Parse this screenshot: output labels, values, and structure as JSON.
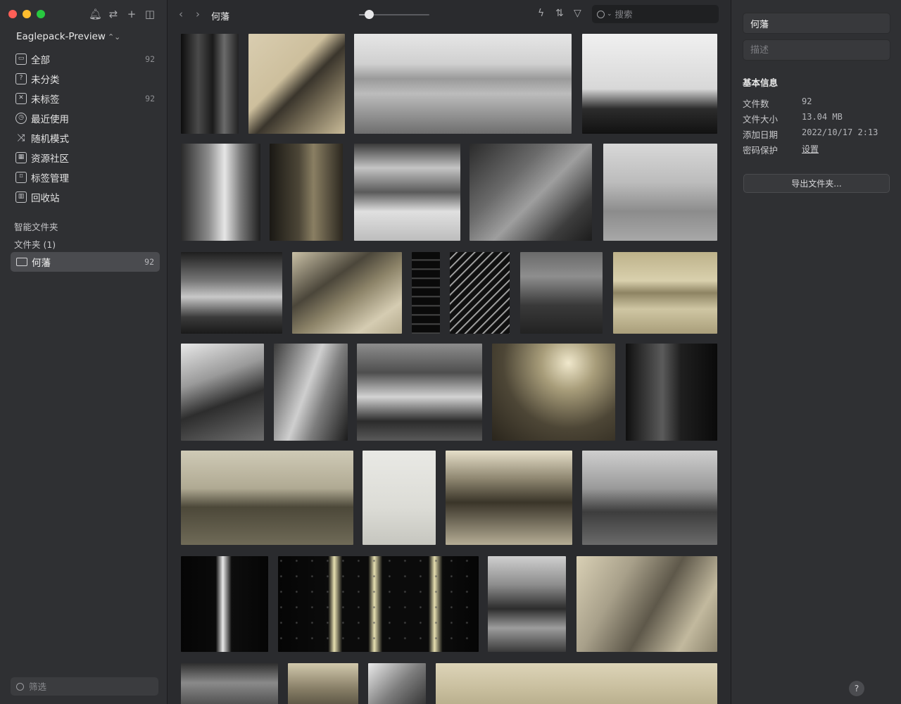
{
  "sidebar": {
    "library_name": "Eaglepack-Preview",
    "nav_items": [
      {
        "label": "全部",
        "count": "92",
        "icon": "inbox-icon"
      },
      {
        "label": "未分类",
        "count": "",
        "icon": "question-box-icon"
      },
      {
        "label": "未标签",
        "count": "92",
        "icon": "tag-off-icon"
      },
      {
        "label": "最近使用",
        "count": "",
        "icon": "clock-icon"
      },
      {
        "label": "随机模式",
        "count": "",
        "icon": "shuffle-icon"
      },
      {
        "label": "资源社区",
        "count": "",
        "icon": "community-icon"
      },
      {
        "label": "标签管理",
        "count": "",
        "icon": "bookmark-icon"
      },
      {
        "label": "回收站",
        "count": "",
        "icon": "trash-icon"
      }
    ],
    "smart_folders_label": "智能文件夹",
    "folders_label": "文件夹 (1)",
    "folder": {
      "label": "何藩",
      "count": "92"
    },
    "filter_placeholder": "筛选"
  },
  "toolbar": {
    "breadcrumb": "何藩",
    "zoom_level": 0.14,
    "search_placeholder": "搜索"
  },
  "inspector": {
    "name_value": "何藩",
    "description_placeholder": "描述",
    "section_title": "基本信息",
    "rows": [
      {
        "key": "文件数",
        "value": "92"
      },
      {
        "key": "文件大小",
        "value": "13.04 MB"
      },
      {
        "key": "添加日期",
        "value": "2022/10/17 2:13"
      },
      {
        "key": "密码保护",
        "value": "设置"
      }
    ],
    "export_label": "导出文件夹...",
    "help_label": "?"
  }
}
